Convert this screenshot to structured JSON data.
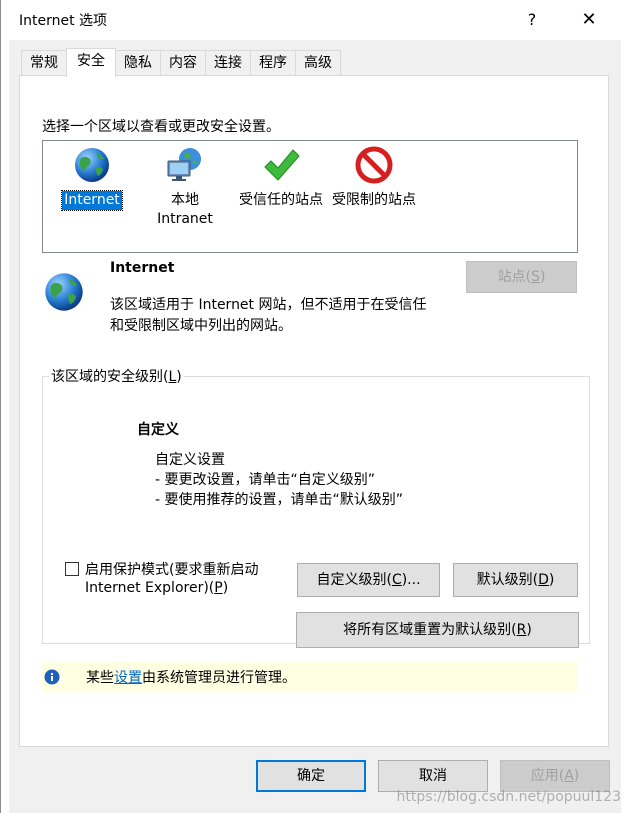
{
  "window": {
    "title": "Internet 选项",
    "help": "?",
    "close": "✕"
  },
  "tabs": [
    {
      "label": "常规"
    },
    {
      "label": "安全"
    },
    {
      "label": "隐私"
    },
    {
      "label": "内容"
    },
    {
      "label": "连接"
    },
    {
      "label": "程序"
    },
    {
      "label": "高级"
    }
  ],
  "security": {
    "prompt": "选择一个区域以查看或更改安全设置。",
    "zones": [
      {
        "line1": "Internet",
        "line2": "",
        "icon": "globe-icon"
      },
      {
        "line1": "本地",
        "line2": "Intranet",
        "icon": "network-computer-icon"
      },
      {
        "line1": "受信任的站点",
        "line2": "",
        "icon": "checkmark-icon"
      },
      {
        "line1": "受限制的站点",
        "line2": "",
        "icon": "no-entry-icon"
      }
    ],
    "selected_zone": {
      "name": "Internet",
      "desc_line1": "该区域适用于 Internet 网站，但不适用于在受信任",
      "desc_line2": "和受限制区域中列出的网站。"
    },
    "sites_btn": {
      "pre": "站点(",
      "key": "S",
      "post": ")"
    },
    "level_group": {
      "pre": "该区域的安全级别(",
      "key": "L",
      "post": ")"
    },
    "level": {
      "name": "自定义",
      "desc": "自定义设置",
      "bullet1": "- 要更改设置，请单击“自定义级别”",
      "bullet2": "- 要使用推荐的设置，请单击“默认级别”"
    },
    "protected_mode": {
      "line1": "启用保护模式(要求重新启动",
      "line2_pre": "Internet Explorer)(",
      "key": "P",
      "post": ")",
      "checked": false
    },
    "custom_btn": {
      "pre": "自定义级别(",
      "key": "C",
      "post": ")..."
    },
    "default_btn": {
      "pre": "默认级别(",
      "key": "D",
      "post": ")"
    },
    "reset_btn": {
      "pre": "将所有区域重置为默认级别(",
      "key": "R",
      "post": ")"
    },
    "info": {
      "pre": "某些",
      "link": "设置",
      "post": "由系统管理员进行管理。"
    }
  },
  "footer": {
    "ok": "确定",
    "cancel": "取消",
    "apply": {
      "pre": "应用(",
      "key": "A",
      "post": ")"
    }
  },
  "watermark": "https://blog.csdn.net/popuul123",
  "colors": {
    "accent": "#0078d7",
    "info_bg": "#ffffe1",
    "dialog_bg": "#f0f0f0"
  }
}
